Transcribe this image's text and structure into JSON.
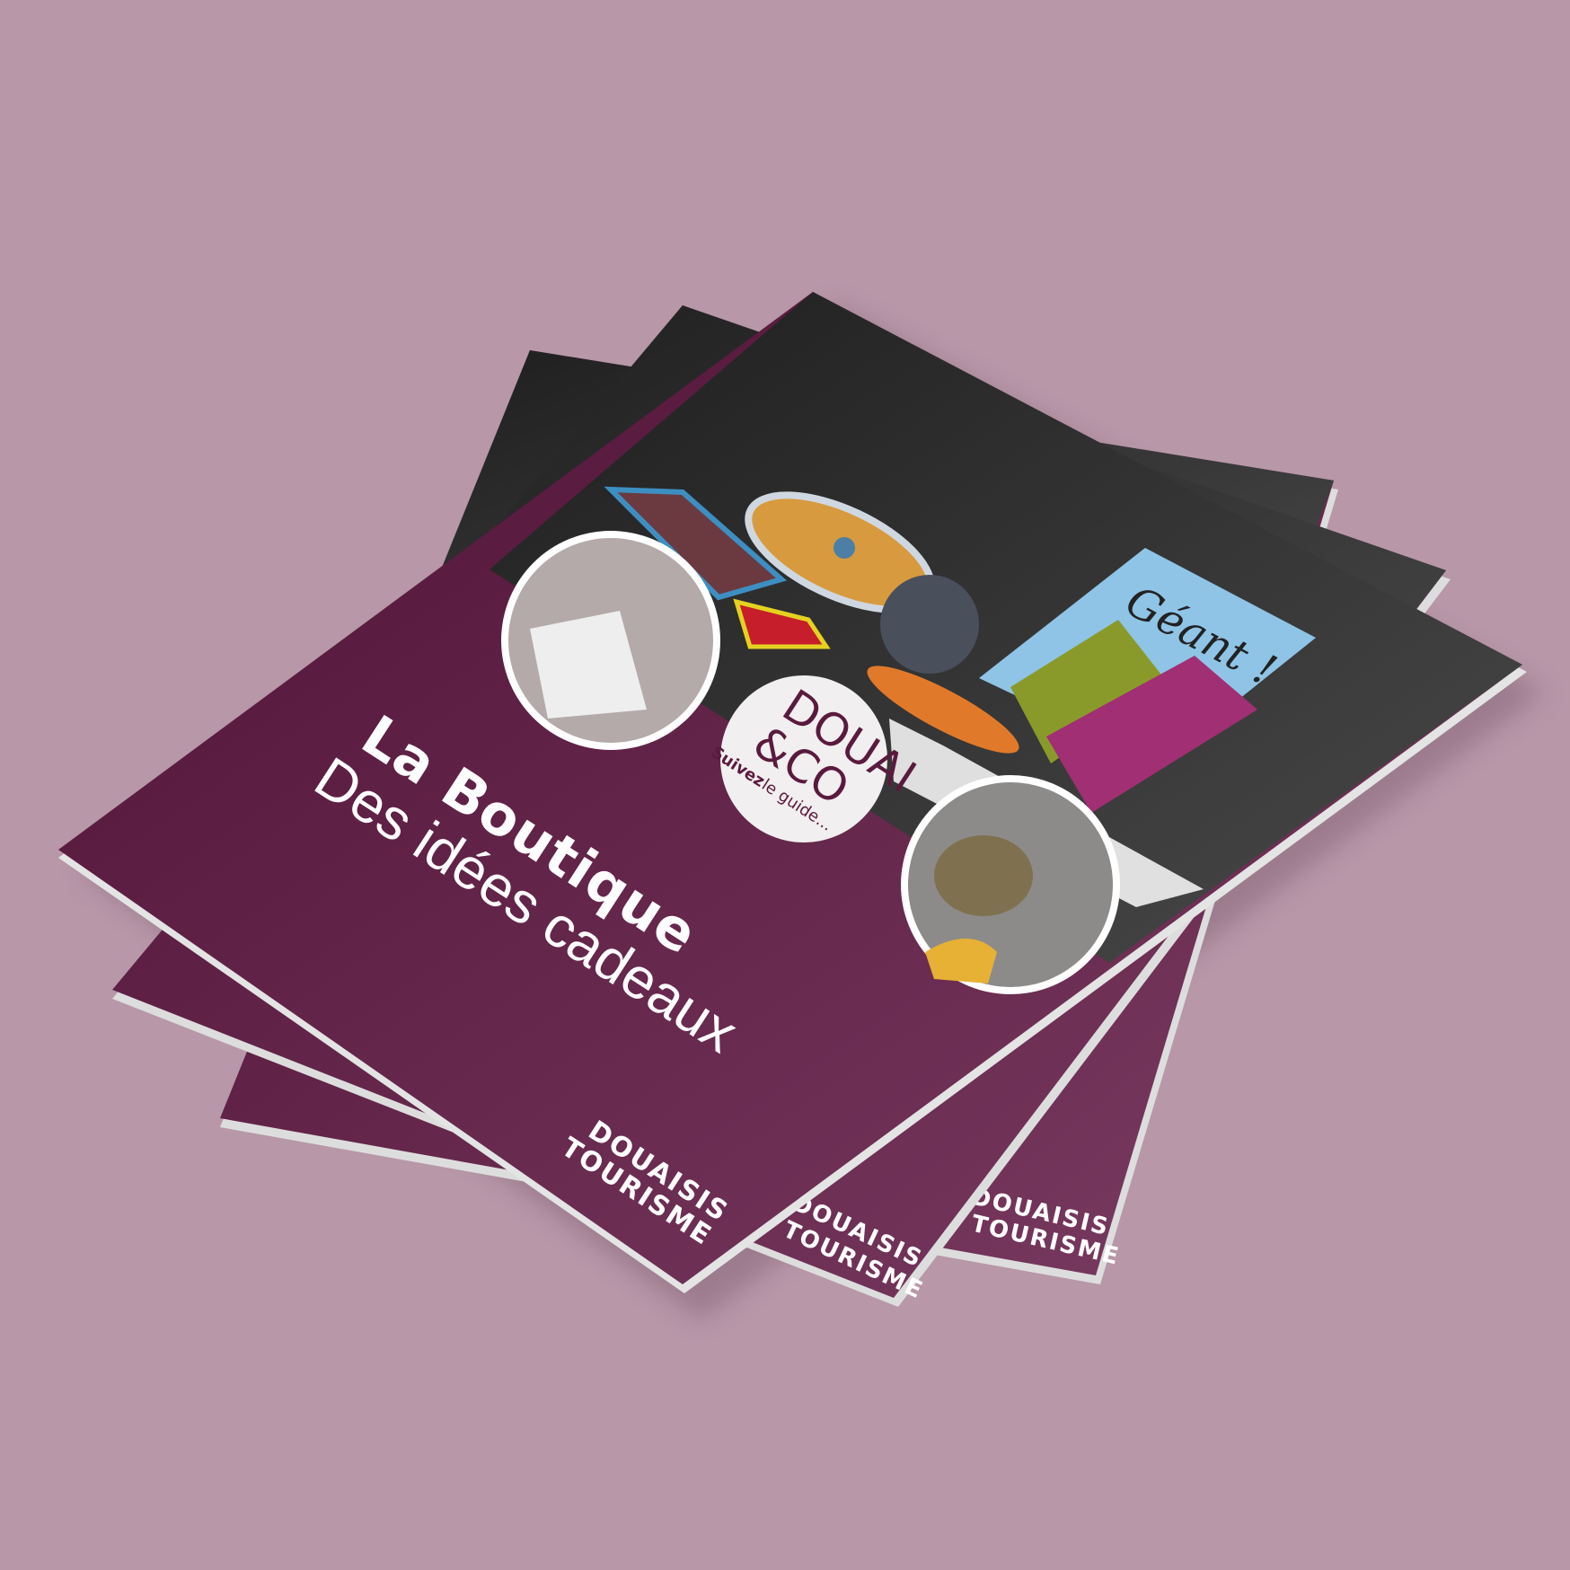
{
  "brochure": {
    "title": "La Boutique",
    "subtitle": "Des idées cadeaux",
    "badge": {
      "brand_line1": "DOUAI",
      "brand_line2": "&CO",
      "tagline_bold": "Suivez",
      "tagline_rest": "le guide..."
    },
    "publisher_line1": "DOUAISIS",
    "publisher_line2": "TOURISME",
    "product_book_title": "Géant !"
  },
  "colors": {
    "background": "#b797a8",
    "cover_purple": "#5a1a3e",
    "cover_dark": "#3a3a3a"
  }
}
